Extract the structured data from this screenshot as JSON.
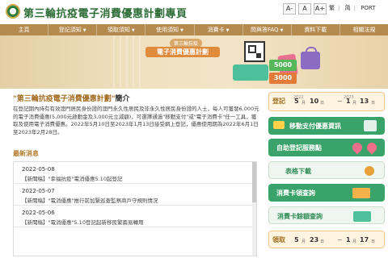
{
  "header": {
    "title": "第三輪抗疫電子消費優惠計劃專頁",
    "font_buttons": [
      "A-",
      "A",
      "A+"
    ],
    "languages": [
      "繁",
      "简",
      "PORT"
    ]
  },
  "nav": {
    "items": [
      "主頁",
      "登記須知",
      "領取須知",
      "使用須知",
      "消費卡",
      "問與答FAQ",
      "資料下載",
      "相關法規"
    ]
  },
  "banner": {
    "subtitle": "第三輪抗疫",
    "title": "電子消費優惠計劃",
    "amounts": [
      "5000",
      "3000"
    ]
  },
  "intro": {
    "title": "\"第三輪抗疫電子消費優惠計劃\"",
    "title_suffix": "簡介",
    "text": "在登記期內持有有效澳門居民身份證的澳門永久性居民及非永久性居民身份證的人士，每人可獲發6,000元的電子消費優惠(5,000元啟動金及3,000元立減額)，可選擇通過\"移動支付\"或\"電子消費卡\"任一工具，獲取及使用電子消費優惠。2022年5月10日至2023年1月13日接受網上登記，優惠使用期為2022年6月1日至2023年2月28日。"
  },
  "news": {
    "title": "最新消息",
    "items": [
      {
        "date": "2022-05-08",
        "text": "【新聞稿】\"幸福抗疫\"電消優惠5.10起登記"
      },
      {
        "date": "2022-05-07",
        "text": "【新聞稿】\"電消優惠\"推行前加緊巡查監察商戶守規則情況"
      },
      {
        "date": "2022-05-06",
        "text": "【新聞稿】\"電消優惠\"5.10登記起新移民繁兩易轉用"
      }
    ]
  },
  "sidebar": {
    "registration": {
      "label": "登記",
      "start_year": "2022",
      "start_month": "5",
      "start_day": "10",
      "end_year": "2023",
      "end_month": "1",
      "end_day": "13",
      "month_unit": "月",
      "day_unit": "日"
    },
    "buttons": [
      {
        "label": "移動支付優惠資訊",
        "style": "green"
      },
      {
        "label": "自助登記服務點",
        "style": "green"
      },
      {
        "label": "表格下載",
        "style": "light"
      },
      {
        "label": "消費卡領查詢",
        "style": "green"
      },
      {
        "label": "消費卡餘額查詢",
        "style": "light"
      },
      {
        "label": "領取",
        "style": "light"
      }
    ],
    "collect": {
      "label": "領取",
      "start_month": "5",
      "start_day": "23",
      "end_month": "1",
      "end_day": "17"
    }
  },
  "colors": {
    "brand_green": "#2b6b34",
    "nav_gold": "#b58a4e",
    "accent_orange": "#e08a3c",
    "side_green": "#3aa36a"
  }
}
